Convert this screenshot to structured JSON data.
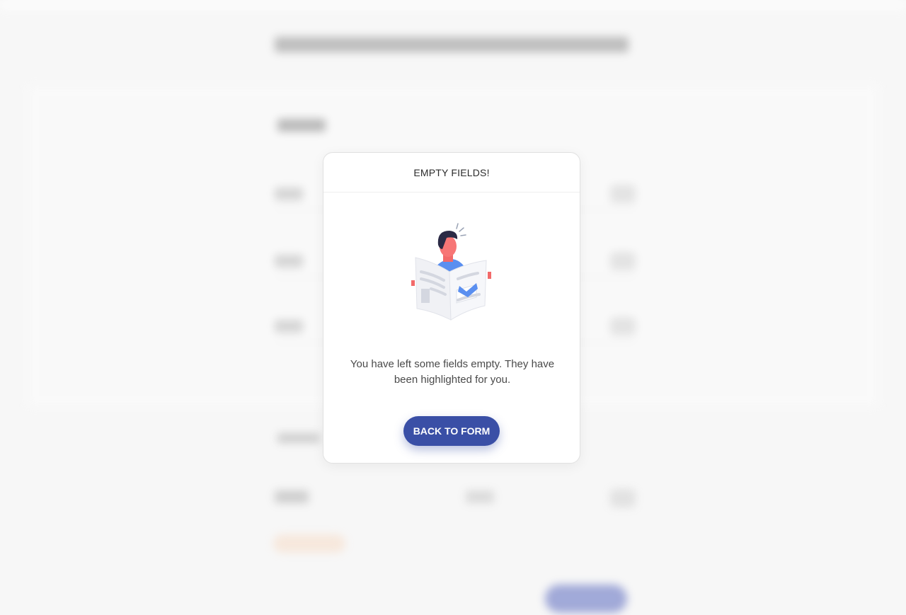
{
  "modal": {
    "title": "EMPTY FIELDS!",
    "message": "You have left some fields empty. They have been highlighted for you.",
    "button_label": "BACK TO FORM",
    "illustration_icon": "person-reading-newspaper-icon"
  },
  "colors": {
    "primary_button": "#3a4fa6",
    "background": "#f7f7f7",
    "modal_border": "#e1e1e1"
  }
}
